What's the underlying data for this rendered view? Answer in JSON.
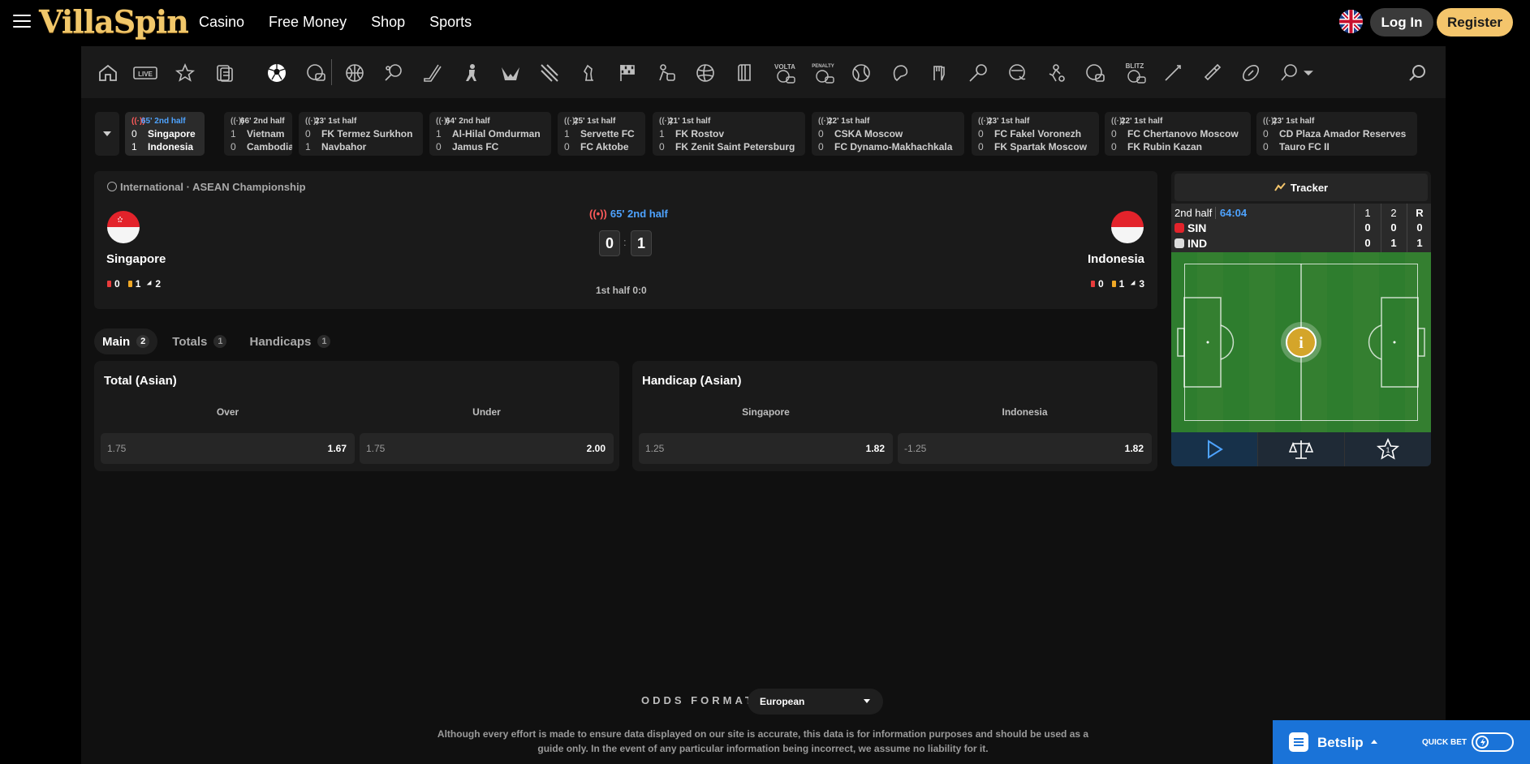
{
  "header": {
    "logo": "VillaSpin",
    "nav": [
      "Casino",
      "Free Money",
      "Shop",
      "Sports"
    ],
    "login": "Log In",
    "register": "Register"
  },
  "sportbar": {
    "icons": [
      "home-icon",
      "live-icon",
      "favorites-icon",
      "betslip-history-icon",
      "soccer-icon",
      "virtual-soccer-icon",
      "basketball-icon",
      "tennis-icon",
      "hockey-icon",
      "ice-hockey-icon",
      "volleyball-icon",
      "esports-icon",
      "chess-icon",
      "motorsport-icon",
      "cricket-icon",
      "rugby-icon",
      "baseball-icon",
      "volta-icon",
      "penalty-icon",
      "handball-icon",
      "table-tennis-icon",
      "boxing-icon",
      "badminton-icon",
      "waterpolo-icon",
      "american-football-icon",
      "virtual-basketball-icon",
      "blitz-icon",
      "darts-icon",
      "snooker-icon",
      "rugby-ball-icon",
      "more-sports-icon"
    ],
    "live_label": "LIVE"
  },
  "live_games": [
    {
      "time": "65' 2nd half",
      "s1": "0",
      "t1": "Singapore",
      "s2": "1",
      "t2": "Indonesia",
      "active": true
    },
    {
      "time": "66' 2nd half",
      "s1": "1",
      "t1": "Vietnam",
      "s2": "0",
      "t2": "Cambodia"
    },
    {
      "time": "23' 1st half",
      "s1": "0",
      "t1": "FK Termez Surkhon",
      "s2": "1",
      "t2": "Navbahor"
    },
    {
      "time": "64' 2nd half",
      "s1": "1",
      "t1": "Al-Hilal Omdurman",
      "s2": "0",
      "t2": "Jamus FC"
    },
    {
      "time": "25' 1st half",
      "s1": "1",
      "t1": "Servette FC",
      "s2": "0",
      "t2": "FC Aktobe"
    },
    {
      "time": "21' 1st half",
      "s1": "1",
      "t1": "FK Rostov",
      "s2": "0",
      "t2": "FK Zenit Saint Petersburg"
    },
    {
      "time": "22' 1st half",
      "s1": "0",
      "t1": "CSKA Moscow",
      "s2": "0",
      "t2": "FC Dynamo-Makhachkala"
    },
    {
      "time": "23' 1st half",
      "s1": "0",
      "t1": "FC Fakel Voronezh",
      "s2": "0",
      "t2": "FK Spartak Moscow"
    },
    {
      "time": "22' 1st half",
      "s1": "0",
      "t1": "FC Chertanovo Moscow",
      "s2": "0",
      "t2": "FK Rubin Kazan"
    },
    {
      "time": "23' 1st half",
      "s1": "0",
      "t1": "CD Plaza Amador Reserves",
      "s2": "0",
      "t2": "Tauro FC II"
    }
  ],
  "match": {
    "breadcrumb_region": "International",
    "breadcrumb_sep": "·",
    "breadcrumb_league": "ASEAN Championship",
    "live_time": "65' 2nd half",
    "home": {
      "name": "Singapore",
      "red": "0",
      "yellow": "1",
      "corners": "2"
    },
    "away": {
      "name": "Indonesia",
      "red": "0",
      "yellow": "1",
      "corners": "3"
    },
    "score_home": "0",
    "score_away": "1",
    "score_sep": ":",
    "half_score": "1st half 0:0"
  },
  "tabs": [
    {
      "label": "Main",
      "count": "2"
    },
    {
      "label": "Totals",
      "count": "1"
    },
    {
      "label": "Handicaps",
      "count": "1"
    }
  ],
  "markets": [
    {
      "title": "Total (Asian)",
      "columns": [
        "Over",
        "Under"
      ],
      "odds": [
        {
          "line": "1.75",
          "price": "1.67"
        },
        {
          "line": "1.75",
          "price": "2.00"
        }
      ]
    },
    {
      "title": "Handicap (Asian)",
      "columns": [
        "Singapore",
        "Indonesia"
      ],
      "odds": [
        {
          "line": "1.25",
          "price": "1.82"
        },
        {
          "line": "-1.25",
          "price": "1.82"
        }
      ]
    }
  ],
  "tracker": {
    "title": "Tracker",
    "period": "2nd half",
    "clock": "64:04",
    "col_headers": [
      "1",
      "2",
      "R"
    ],
    "rows": [
      {
        "team": "SIN",
        "values": [
          "0",
          "0",
          "0"
        ]
      },
      {
        "team": "IND",
        "values": [
          "0",
          "1",
          "1"
        ]
      }
    ],
    "info_icon": "info-icon",
    "bottom_icons": [
      "play-icon",
      "scales-icon",
      "star-1-icon"
    ],
    "star_number": "1"
  },
  "footer": {
    "odds_format_label": "ODDS FORMAT",
    "odds_format_value": "European",
    "disclaimer": "Although every effort is made to ensure data displayed on our site is accurate, this data is for information purposes and should be used as a guide only. In the event of any particular information being incorrect, we assume no liability for it."
  },
  "betslip": {
    "label": "Betslip",
    "quick_bet": "QUICK BET"
  },
  "colors": {
    "accent_blue": "#4ea3ff",
    "register_gold": "#f4c56c",
    "betslip_blue": "#1a73d8",
    "live_red": "#ff5b5b"
  }
}
